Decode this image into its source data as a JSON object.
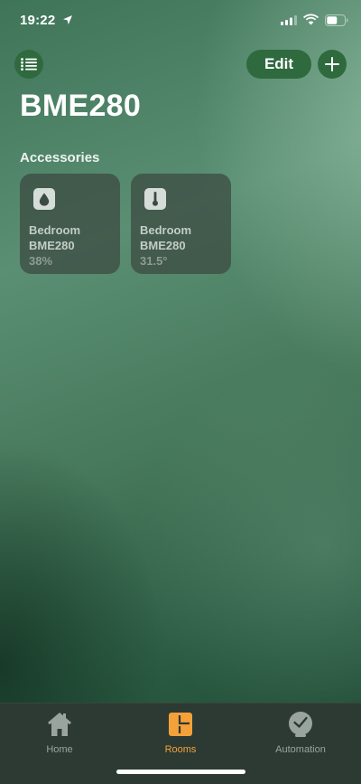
{
  "status_bar": {
    "time": "19:22",
    "icons": [
      "location-arrow-icon",
      "cellular-signal-icon",
      "wifi-icon",
      "battery-icon"
    ]
  },
  "header": {
    "list_icon": "list-icon",
    "edit_label": "Edit",
    "add_icon": "plus-icon"
  },
  "page": {
    "title": "BME280",
    "section_title": "Accessories"
  },
  "accessories": [
    {
      "icon": "humidity-drop-icon",
      "room": "Bedroom",
      "name": "BME280",
      "value": "38%"
    },
    {
      "icon": "thermometer-icon",
      "room": "Bedroom",
      "name": "BME280",
      "value": "31.5°"
    }
  ],
  "tab_bar": {
    "tabs": [
      {
        "label": "Home",
        "icon": "home-icon",
        "active": false
      },
      {
        "label": "Rooms",
        "icon": "rooms-icon",
        "active": true
      },
      {
        "label": "Automation",
        "icon": "automation-clock-icon",
        "active": false
      }
    ]
  },
  "colors": {
    "accent_button": "#2f6a3f",
    "active_tab": "#f4a13a",
    "inactive_tab": "#9aa49f",
    "tab_bar_bg": "#2c3a33",
    "tile_bg": "#3a4840"
  }
}
